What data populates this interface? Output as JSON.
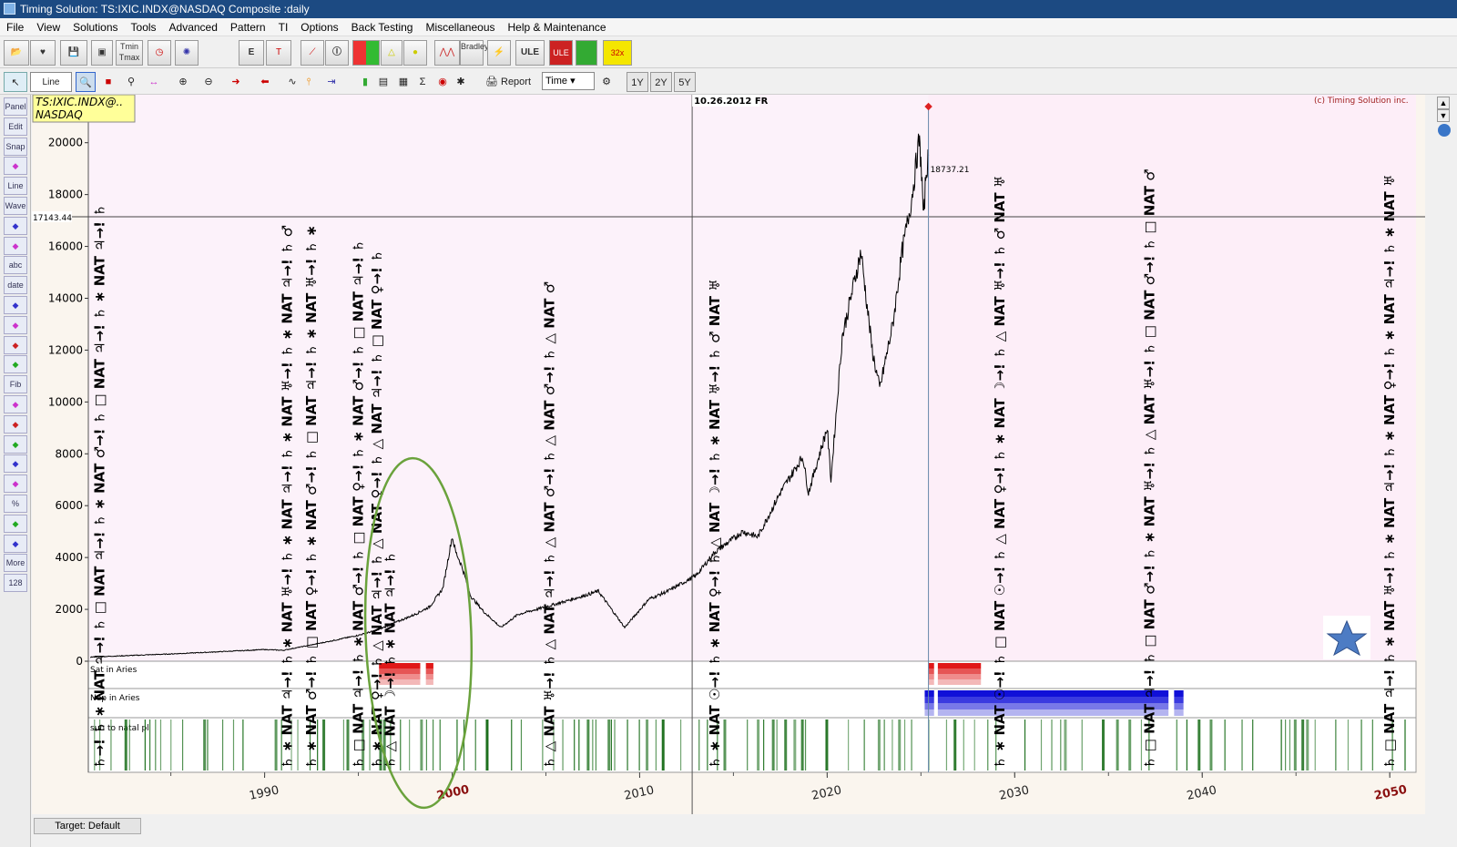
{
  "window": {
    "title": "Timing Solution:  TS:IXIC.INDX@NASDAQ Composite :daily"
  },
  "menu": [
    "File",
    "View",
    "Solutions",
    "Tools",
    "Advanced",
    "Pattern",
    "TI",
    "Options",
    "Back Testing",
    "Miscellaneous",
    "Help & Maintenance"
  ],
  "toolbar": {
    "tmin_label": "Tmin",
    "tmax_label": "Tmax",
    "bradley_label": "Bradley",
    "ule_label": "ULE",
    "ule2_label": "ULE",
    "speed_label": "32x",
    "report_label": "Report",
    "time_select": "Time",
    "span_buttons": [
      "1Y",
      "2Y",
      "5Y"
    ],
    "line_label": "Line"
  },
  "sidebar_items": [
    {
      "label": "Panel",
      "icon": "panel-icon"
    },
    {
      "label": "Edit",
      "icon": "edit-icon"
    },
    {
      "label": "Snap",
      "icon": "snap-icon"
    },
    {
      "label": "",
      "icon": "heart-icon"
    },
    {
      "label": "Line",
      "icon": "line-icon"
    },
    {
      "label": "Wave",
      "icon": "wave-icon"
    },
    {
      "label": "",
      "icon": "fan-icon"
    },
    {
      "label": "",
      "icon": "color-icon"
    },
    {
      "label": "abc",
      "icon": "text-icon"
    },
    {
      "label": "date",
      "icon": "date-icon"
    },
    {
      "label": "",
      "icon": "channel-icon"
    },
    {
      "label": "",
      "icon": "hatch-icon"
    },
    {
      "label": "",
      "icon": "grid-icon"
    },
    {
      "label": "",
      "icon": "zigzag-icon"
    },
    {
      "label": "Fib",
      "icon": "fib-icon"
    },
    {
      "label": "",
      "icon": "arc-icon"
    },
    {
      "label": "",
      "icon": "cross-icon"
    },
    {
      "label": "",
      "icon": "palette-icon"
    },
    {
      "label": "",
      "icon": "lines-icon"
    },
    {
      "label": "",
      "icon": "doc-icon"
    },
    {
      "label": "%",
      "icon": "percent-icon"
    },
    {
      "label": "",
      "icon": "candle-icon"
    },
    {
      "label": "",
      "icon": "trend-icon"
    },
    {
      "label": "More",
      "icon": "more-icon"
    },
    {
      "label": "128",
      "icon": "count-icon"
    }
  ],
  "chart_data": {
    "type": "line",
    "symbol_box": "TS:IXIC.INDX@..\nNASDAQ",
    "copyright": "(c) Timing Solution inc.",
    "cursor_date": "10.26.2012 FR",
    "price_label": "18737.21",
    "cursor_price_label": "17143.44",
    "y_ticks": [
      0,
      2000,
      4000,
      6000,
      8000,
      10000,
      12000,
      14000,
      16000,
      18000,
      20000
    ],
    "x_ticks": [
      "1990",
      "2000",
      "2010",
      "2020",
      "2030",
      "2040",
      "2050"
    ],
    "x_range": [
      1980.6,
      2051.4
    ],
    "y_range": [
      0,
      21500
    ],
    "grid": false,
    "series": [
      {
        "x": [
          1980.7,
          1985,
          1988,
          1990,
          1991,
          1993,
          1995,
          1996,
          1997,
          1998,
          1998.8,
          1999.5,
          2000.0,
          2000.2,
          2000.5,
          2001,
          2001.7,
          2002.6,
          2003.5,
          2004.5,
          2006,
          2007.8,
          2008.9,
          2009.2,
          2010.5,
          2011.5,
          2013,
          2014,
          2015.5,
          2016.3,
          2017.5,
          2018.7,
          2019.0,
          2020.0,
          2020.2,
          2020.8,
          2021.8,
          2022.4,
          2022.8,
          2023.5,
          2024.0,
          2024.5,
          2024.9,
          2025.0,
          2025.15,
          2025.25,
          2025.4
        ],
        "y": [
          160,
          280,
          380,
          450,
          420,
          700,
          1000,
          1200,
          1500,
          1800,
          2100,
          2800,
          4800,
          4200,
          3700,
          2500,
          1900,
          1300,
          1800,
          2000,
          2300,
          2700,
          1600,
          1300,
          2400,
          2700,
          3300,
          4200,
          5000,
          4800,
          6500,
          7900,
          6500,
          9000,
          7000,
          12500,
          15800,
          12000,
          10500,
          13000,
          15800,
          17800,
          20100,
          19300,
          17000,
          18700,
          19500
        ]
      }
    ],
    "projection_start": 2025.4,
    "events": [
      1981.2,
      1991.2,
      1992.5,
      1995.0,
      1996.0,
      1996.7,
      2005.2,
      2014.0,
      2029.2,
      2037.2,
      2050.0
    ],
    "event_labels": [
      "♄→! ♄ ∗ NAT ♃→! ♄ □ NAT ♃→! ♄ ∗ NAT ♂→! ♄ □ NAT ♃→! ♄ ∗ NAT ♃→! ♄",
      "♄ ∗ NAT ♃→! ♄ ∗ NAT ♅→! ♄ ∗ NAT ♃→! ♄ ∗ NAT ♅→! ♄ ∗ NAT ♃→! ♄ ♂",
      "♄ ∗ NAT ♂→! ♄ □ NAT ♀→! ♄ ∗ NAT ♂→! ♄ □ NAT ♃→! ♄ ∗ NAT ♅→! ♄ ∗",
      "♄ □ NAT ♃→! ♄ ∗ NAT ♂→! ♄ □ NAT ♀→! ♄ ∗ NAT ♂→! ♄ □ NAT ♃→! ♄",
      "♄ ∗ NAT ♀→! ♄ △ NAT ♃→! ♄ △ NAT ♀→! ♄ △ NAT ♃→! ♄ □ NAT ♀→! ♄",
      "♄ △ NAT ☽→! ♄ ∗ NAT ♃→! ♄",
      "♄ △ NAT ♅→! ♄ △ NAT ♃→! ♄ △ NAT ♂→! ♄ △ NAT ♂→! ♄ △ NAT ♂",
      "♄ ∗ NAT ☉→! ♄ ∗ NAT ♀→! ♄ △ NAT ☽→! ♄ ∗ NAT ♅→! ♄ ♂ NAT ♅",
      "♄ ∗ NAT ☉→! ♄ □ NAT ☉→! ♄ △ NAT ♀→! ♄ ∗ NAT ☽→! ♄ △ NAT ♅→! ♄ ♂ NAT ♅",
      "♄ □ NAT ♃→! ♄ □ NAT ♂→! ♄ ∗ NAT ♅→! ♄ △ NAT ♅→! ♄ □ NAT ♂→! ♄ □ NAT ♂",
      "♄ □ NAT ♃→! ♄ ∗ NAT ♅→! ♄ ∗ NAT ♃→! ♄ ∗ NAT ♀→! ♄ ∗ NAT ♃→! ♄ ∗ NAT ♅"
    ],
    "panels": {
      "saturn_aries": "Sat in Aries",
      "neptune_aries": "Nep in Aries",
      "natal": "sun to natal pl"
    },
    "saturn_aries_ranges": [
      [
        1996.1,
        1998.3
      ],
      [
        1998.6,
        1999.0
      ],
      [
        2025.4,
        2025.7
      ],
      [
        2025.9,
        2028.2
      ]
    ],
    "neptune_aries_ranges": [
      [
        2025.2,
        2025.7
      ],
      [
        2025.9,
        2038.2
      ],
      [
        2038.5,
        2039.0
      ]
    ],
    "colors": {
      "plot_bg": "#fcf2fa",
      "projection_bg": "#fdeef8",
      "natal_bar": "#1a6e1a",
      "saturn_bar": "#e21a1a",
      "neptune_bar": "#1212d6",
      "ellipse": "#6aa23c",
      "x_accent": "#8a1010"
    }
  },
  "statusbar": {
    "target_tab": "Target: Default"
  }
}
